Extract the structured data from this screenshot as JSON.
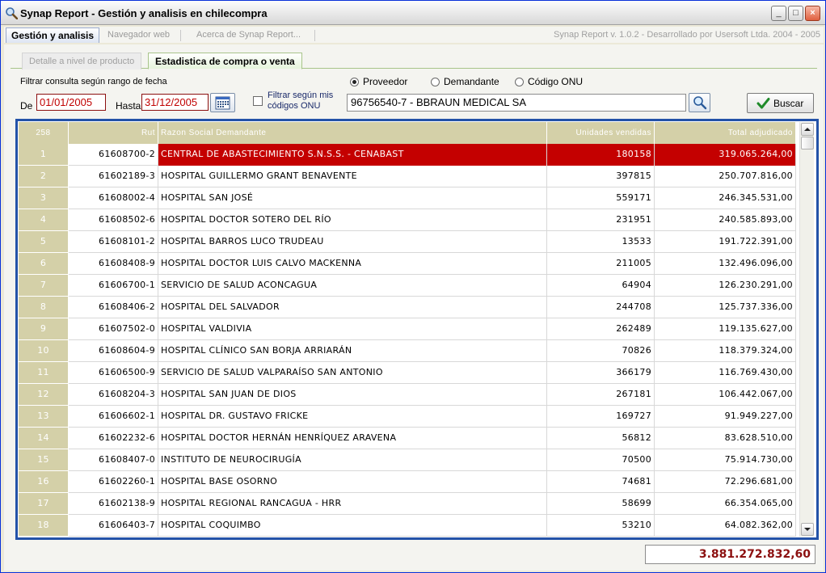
{
  "window": {
    "title": "Synap Report - Gestión y analisis en chilecompra",
    "controls": {
      "minimize": "_",
      "maximize": "□",
      "close": "×"
    }
  },
  "main_tabs": [
    {
      "label": "Gestión y analisis",
      "active": true
    },
    {
      "label": "Navegador web",
      "active": false
    },
    {
      "label": "Acerca de Synap Report...",
      "active": false
    }
  ],
  "version": "Synap Report v. 1.0.2 - Desarrollado por Usersoft Ltda. 2004 - 2005",
  "sub_tabs": [
    {
      "label": "Detalle a nivel de producto",
      "active": false
    },
    {
      "label": "Estadistica de compra o venta",
      "active": true
    }
  ],
  "filters": {
    "date_range_label": "Filtrar consulta según rango de fecha",
    "from_label": "De",
    "from_value": "01/01/2005",
    "to_label": "Hasta",
    "to_value": "31/12/2005",
    "onu_filter_label_line1": "Filtrar según mis",
    "onu_filter_label_line2": "códigos ONU",
    "onu_filter_checked": false,
    "radios": [
      {
        "label": "Proveedor",
        "checked": true
      },
      {
        "label": "Demandante",
        "checked": false
      },
      {
        "label": "Código ONU",
        "checked": false
      }
    ],
    "search_value": "96756540-7 - BBRAUN MEDICAL SA",
    "search_button_label": "Buscar"
  },
  "grid": {
    "headers": {
      "count": "258",
      "rut": "Rut",
      "name": "Razon Social Demandante",
      "units": "Unidades vendidas",
      "total": "Total adjudicado"
    },
    "rows": [
      {
        "idx": "1",
        "rut": "61608700-2",
        "name": "CENTRAL DE ABASTECIMIENTO S.N.S.S. -  CENABAST",
        "units": "180158",
        "total": "319.065.264,00",
        "selected": true
      },
      {
        "idx": "2",
        "rut": "61602189-3",
        "name": "HOSPITAL GUILLERMO GRANT BENAVENTE",
        "units": "397815",
        "total": "250.707.816,00"
      },
      {
        "idx": "3",
        "rut": "61608002-4",
        "name": "HOSPITAL SAN JOSÉ",
        "units": "559171",
        "total": "246.345.531,00"
      },
      {
        "idx": "4",
        "rut": "61608502-6",
        "name": "HOSPITAL DOCTOR SOTERO DEL RÍO",
        "units": "231951",
        "total": "240.585.893,00"
      },
      {
        "idx": "5",
        "rut": "61608101-2",
        "name": "HOSPITAL BARROS LUCO TRUDEAU",
        "units": "13533",
        "total": "191.722.391,00"
      },
      {
        "idx": "6",
        "rut": "61608408-9",
        "name": "HOSPITAL DOCTOR LUIS CALVO MACKENNA",
        "units": "211005",
        "total": "132.496.096,00"
      },
      {
        "idx": "7",
        "rut": "61606700-1",
        "name": "SERVICIO DE SALUD ACONCAGUA",
        "units": "64904",
        "total": "126.230.291,00"
      },
      {
        "idx": "8",
        "rut": "61608406-2",
        "name": "HOSPITAL DEL SALVADOR",
        "units": "244708",
        "total": "125.737.336,00"
      },
      {
        "idx": "9",
        "rut": "61607502-0",
        "name": "HOSPITAL VALDIVIA",
        "units": "262489",
        "total": "119.135.627,00"
      },
      {
        "idx": "10",
        "rut": "61608604-9",
        "name": "HOSPITAL CLÍNICO SAN BORJA ARRIARÁN",
        "units": "70826",
        "total": "118.379.324,00"
      },
      {
        "idx": "11",
        "rut": "61606500-9",
        "name": "SERVICIO DE SALUD VALPARAÍSO SAN ANTONIO",
        "units": "366179",
        "total": "116.769.430,00"
      },
      {
        "idx": "12",
        "rut": "61608204-3",
        "name": "HOSPITAL SAN JUAN DE DIOS",
        "units": "267181",
        "total": "106.442.067,00"
      },
      {
        "idx": "13",
        "rut": "61606602-1",
        "name": "HOSPITAL DR. GUSTAVO FRICKE",
        "units": "169727",
        "total": "91.949.227,00"
      },
      {
        "idx": "14",
        "rut": "61602232-6",
        "name": "HOSPITAL DOCTOR HERNÁN HENRÍQUEZ ARAVENA",
        "units": "56812",
        "total": "83.628.510,00"
      },
      {
        "idx": "15",
        "rut": "61608407-0",
        "name": "INSTITUTO DE NEUROCIRUGÍA",
        "units": "70500",
        "total": "75.914.730,00"
      },
      {
        "idx": "16",
        "rut": "61602260-1",
        "name": "HOSPITAL BASE OSORNO",
        "units": "74681",
        "total": "72.296.681,00"
      },
      {
        "idx": "17",
        "rut": "61602138-9",
        "name": "HOSPITAL REGIONAL RANCAGUA - HRR",
        "units": "58699",
        "total": "66.354.065,00"
      },
      {
        "idx": "18",
        "rut": "61606403-7",
        "name": "HOSPITAL COQUIMBO",
        "units": "53210",
        "total": "64.082.362,00"
      }
    ]
  },
  "grand_total": "3.881.272.832,60",
  "colors": {
    "selected_row": "#c40000",
    "grid_border": "#2352a8",
    "header_bg": "#d4d0a8",
    "date_text": "#c00000",
    "total_text": "#8c1010"
  }
}
